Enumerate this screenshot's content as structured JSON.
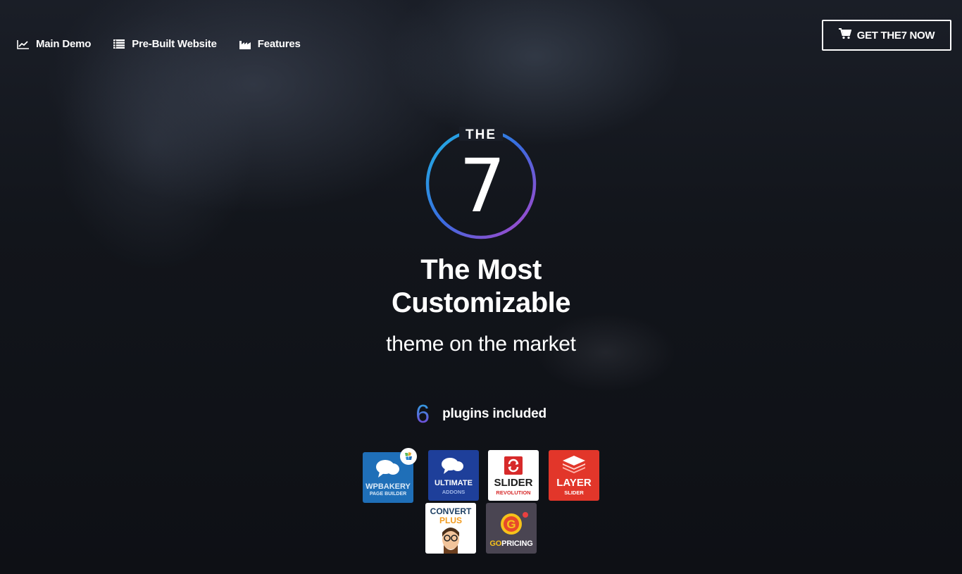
{
  "nav": {
    "items": [
      {
        "label": "Main Demo",
        "icon": "line-chart-icon"
      },
      {
        "label": "Pre-Built Website",
        "icon": "list-icon"
      },
      {
        "label": "Features",
        "icon": "factory-icon"
      }
    ],
    "cta": {
      "label": "GET THE7 NOW",
      "icon": "cart-icon"
    }
  },
  "logo": {
    "top_text": "THE",
    "number": "7"
  },
  "hero": {
    "line1": "The Most",
    "line2": "Customizable",
    "subtitle": "theme on the market"
  },
  "plugins": {
    "count": "6",
    "label": "plugins included",
    "badges": [
      {
        "name": "wpbakery",
        "line1": "WPBAKERY",
        "line2": "PAGE BUILDER",
        "color": "#1f6fb8"
      },
      {
        "name": "ultimate-addons",
        "line1": "ULTIMATE",
        "line2": "ADDONS",
        "color": "#1e3f9a"
      },
      {
        "name": "slider-revolution",
        "line1": "SLIDER",
        "line2": "REVOLUTION",
        "color": "#ffffff"
      },
      {
        "name": "layer-slider",
        "line1": "LAYER",
        "line2": "SLIDER",
        "color": "#e2362a"
      },
      {
        "name": "convert-plus",
        "line1": "CONVERT",
        "line2": "PLUS",
        "color": "#ffffff"
      },
      {
        "name": "go-pricing",
        "line1": "GO",
        "line2": "PRICING",
        "color": "#4a4552"
      }
    ]
  }
}
